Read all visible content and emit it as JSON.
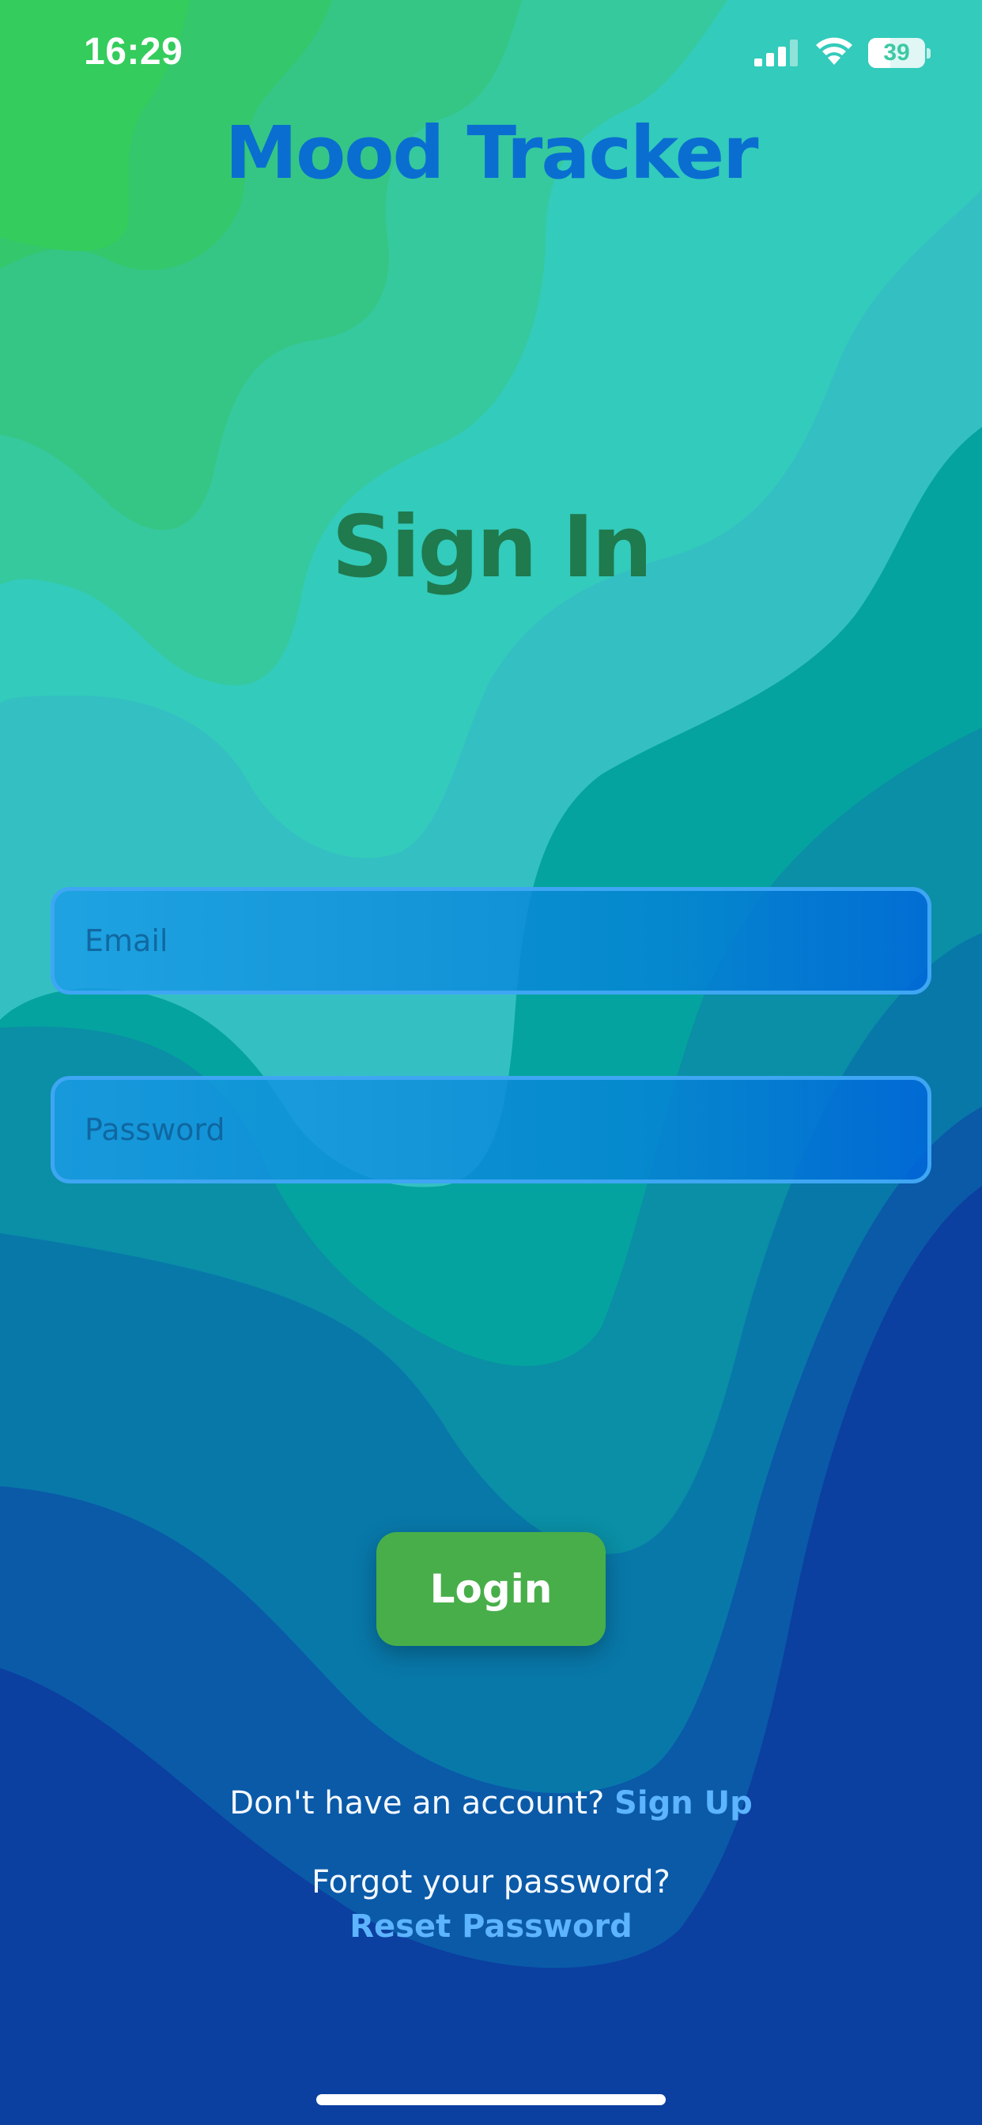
{
  "status_bar": {
    "time": "16:29",
    "battery_percent": "39",
    "icons": [
      "signal-icon",
      "wifi-icon",
      "battery-icon"
    ]
  },
  "app": {
    "title": "Mood Tracker"
  },
  "page": {
    "title": "Sign In"
  },
  "form": {
    "email": {
      "placeholder": "Email",
      "value": ""
    },
    "password": {
      "placeholder": "Password",
      "value": ""
    },
    "login_label": "Login"
  },
  "footer": {
    "signup_prompt": "Don't have an account?",
    "signup_link": "Sign Up",
    "forgot_prompt": "Forgot your password?",
    "reset_link": "Reset Password"
  },
  "colors": {
    "title_blue": "#0a6ed1",
    "heading_green": "#1f7a4e",
    "login_green": "#48ae4a",
    "link_blue": "#5db4ff"
  }
}
